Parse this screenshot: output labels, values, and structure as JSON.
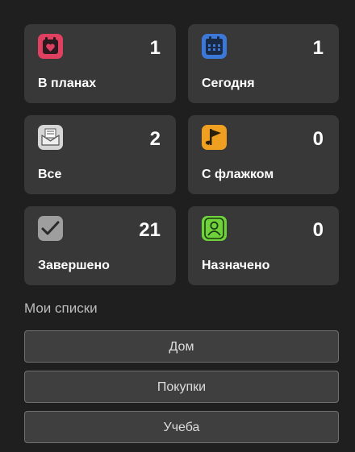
{
  "cards": [
    {
      "label": "В планах",
      "count": "1",
      "icon": "schedule-heart-icon",
      "icon_color": "#e0405f"
    },
    {
      "label": "Сегодня",
      "count": "1",
      "icon": "calendar-icon",
      "icon_color": "#3c78d8"
    },
    {
      "label": "Все",
      "count": "2",
      "icon": "inbox-envelope-icon",
      "icon_color": "#d6d6d6"
    },
    {
      "label": "С флажком",
      "count": "0",
      "icon": "flag-icon",
      "icon_color": "#f0a020"
    },
    {
      "label": "Завершено",
      "count": "21",
      "icon": "checkmark-icon",
      "icon_color": "#9e9e9e"
    },
    {
      "label": "Назначено",
      "count": "0",
      "icon": "person-icon",
      "icon_color": "#6fd13b"
    }
  ],
  "my_lists": {
    "title": "Мои списки",
    "items": [
      "Дом",
      "Покупки",
      "Учеба"
    ]
  },
  "colors": {
    "background": "#1f1f1f",
    "card": "#383838",
    "list_button": "#3f3f3f"
  }
}
